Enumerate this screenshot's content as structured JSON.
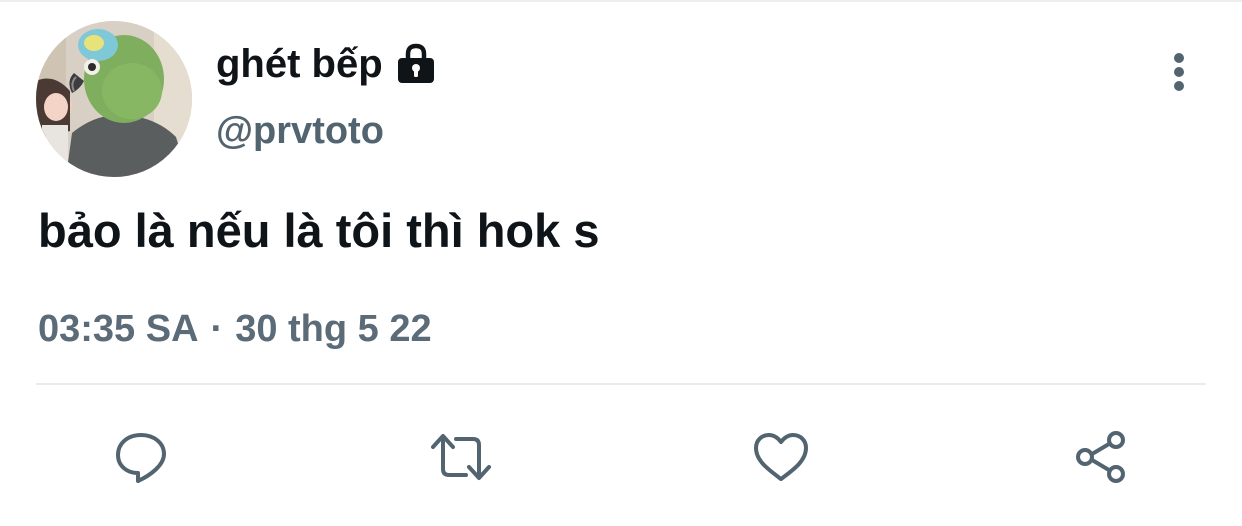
{
  "author": {
    "display_name": "ghét bếp",
    "handle": "@prvtoto",
    "protected_icon": "lock-icon",
    "avatar_icon": "avatar-photo"
  },
  "tweet": {
    "text": "bảo là nếu là tôi thì hok s",
    "time": "03:35 SA",
    "separator": "·",
    "date": "30 thg 5 22"
  },
  "actions": {
    "reply_icon": "reply-icon",
    "retweet_icon": "retweet-icon",
    "like_icon": "heart-icon",
    "share_icon": "share-icon",
    "more_icon": "more-vertical-icon"
  },
  "colors": {
    "text_primary": "#0f1419",
    "text_secondary": "#536471",
    "icon": "#536471",
    "divider": "#e8eaec",
    "background": "#ffffff"
  }
}
